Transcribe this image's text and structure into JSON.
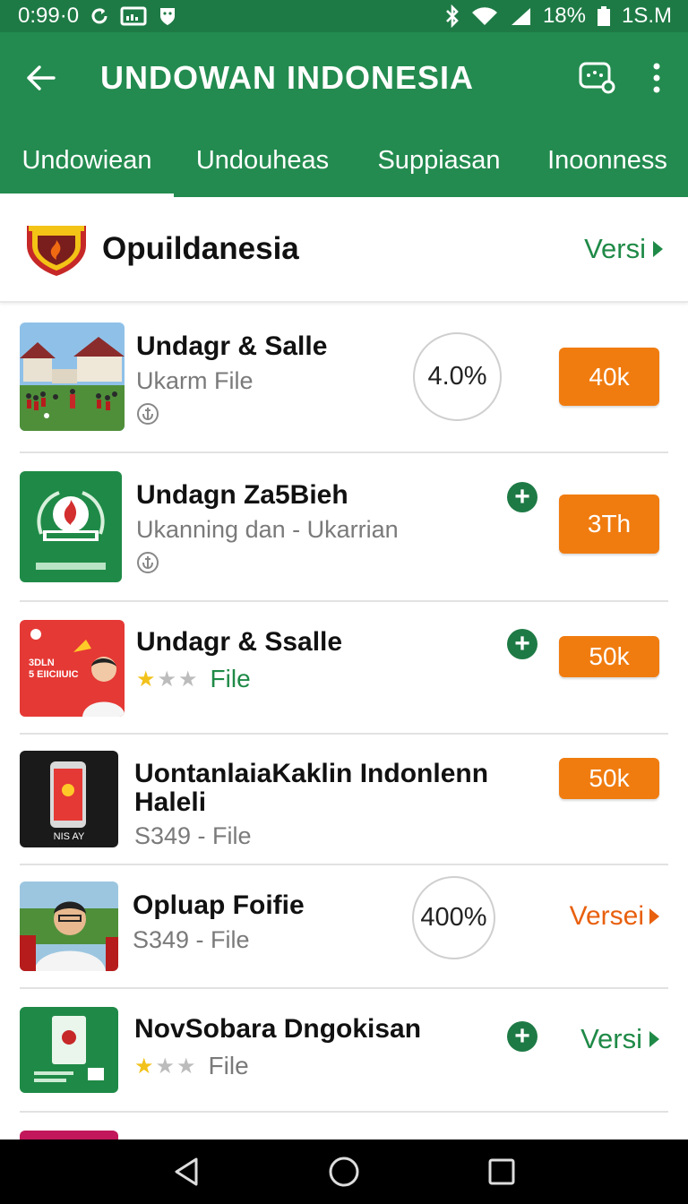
{
  "status": {
    "time": "0:99·0",
    "battery": "18%",
    "right_text": "1S.M"
  },
  "appbar": {
    "title": "UNDOWAN INDONESIA"
  },
  "tabs": [
    {
      "label": "Undowiean",
      "active": true
    },
    {
      "label": "Undouheas",
      "active": false
    },
    {
      "label": "Suppiasan",
      "active": false
    },
    {
      "label": "Inoonness",
      "active": false
    }
  ],
  "header": {
    "title": "Opuildanesia",
    "link": "Versi"
  },
  "items": [
    {
      "name": "Undagr & Salle",
      "subtitle": "Ukarm File",
      "percent": "4.0%",
      "button": "40k"
    },
    {
      "name": "Undagn Za5Bieh",
      "subtitle": "Ukanning dan - Ukarrian",
      "button": "3Th"
    },
    {
      "name": "Undagr & Ssalle",
      "file_label": "File",
      "rating": 1,
      "button": "50k",
      "logo_text": "3DLN\n5 EIICIIUIC"
    },
    {
      "name_line1": "UontanlaiaKaklin Indonlenn",
      "name_line2": "Haleli",
      "subtitle": "S349 - File",
      "button": "50k",
      "device_text": "NIS AY"
    },
    {
      "name": "Opluap Foifie",
      "subtitle": "S349 - File",
      "percent": "400%",
      "link": "Versei"
    },
    {
      "name": "NovSobara Dngokisan",
      "file_label": "File",
      "rating": 1,
      "link": "Versi"
    }
  ],
  "colors": {
    "primary": "#238b4f",
    "status": "#1e7a45",
    "accent_orange": "#f07c10",
    "link_green": "#1f8a47"
  }
}
